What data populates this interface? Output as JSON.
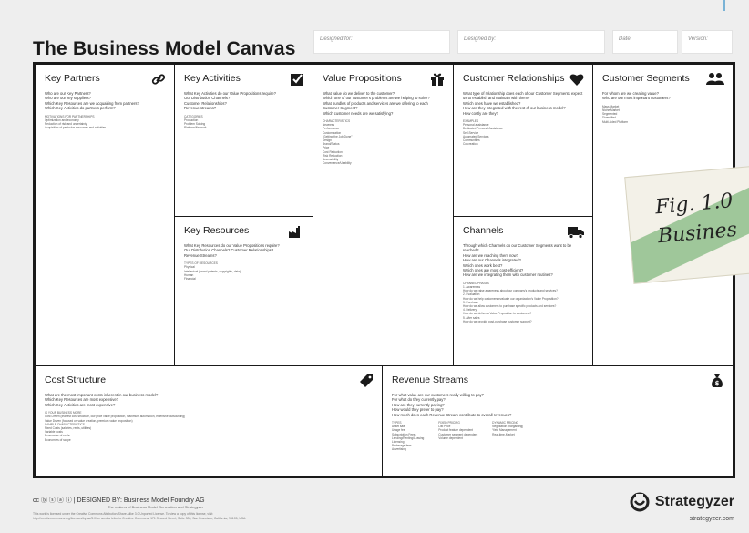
{
  "title": "The Business Model Canvas",
  "fields": {
    "designed_for": "Designed for:",
    "designed_by": "Designed by:",
    "date": "Date:",
    "version": "Version:"
  },
  "blocks": {
    "key_partners": {
      "title": "Key Partners",
      "questions": "Who are our Key Partners?\nWho are our key suppliers?\nWhich Key Resources are we acquairing from partners?\nWhich Key Activities do partners perform?",
      "sub": "MOTIVATIONS FOR PARTNERSHIPS\nOptimization and economy\nReduction of risk and uncertainty\nAcquisition of particular resources and activities"
    },
    "key_activities": {
      "title": "Key Activities",
      "questions": "What Key Activities do our Value Propositions require?\nOur Distribution Channels?\nCustomer Relationships?\nRevenue streams?",
      "sub": "CATEGORIES\nProduction\nProblem Solving\nPlatform/Network"
    },
    "key_resources": {
      "title": "Key Resources",
      "questions": "What Key Resources do our Value Propositions require?\nOur Distribution Channels? Customer Relationships?\nRevenue Streams?",
      "sub": "TYPES OF RESOURCES\nPhysical\nIntellectual (brand patents, copyrights, data)\nHuman\nFinancial"
    },
    "value_propositions": {
      "title": "Value Propositions",
      "questions": "What value do we deliver to the customer?\nWhich one of our customer's problems are we helping to solve?\nWhat bundles of products and services are we offering to each Customer Segment?\nWhich customer needs are we satisfying?",
      "sub": "CHARACTERISTICS\nNewness\nPerformance\nCustomization\n\"Getting the Job Done\"\nDesign\nBrand/Status\nPrice\nCost Reduction\nRisk Reduction\nAccessibility\nConvenience/Usability"
    },
    "customer_relationships": {
      "title": "Customer Relationships",
      "questions": "What type of relationship does each of our Customer Segments expect us to establish and maintain with them?\nWhich ones have we established?\nHow are they integrated with the rest of our business model?\nHow costly are they?",
      "sub": "EXAMPLES\nPersonal assistance\nDedicated Personal Assistance\nSelf-Service\nAutomated Services\nCommunities\nCo-creation"
    },
    "channels": {
      "title": "Channels",
      "questions": "Through which Channels do our Customer Segments want to be reached?\nHow are we reaching them now?\nHow are our Channels integrated?\nWhich ones work best?\nWhich ones are most cost-efficient?\nHow are we integrating them with customer routines?",
      "sub": "CHANNEL PHASES\n1. Awareness\nHow do we raise awareness about our company's products and services?\n2. Evaluation\nHow do we help customers evaluate our organization's Value Proposition?\n3. Purchase\nHow do we allow customers to purchase specific products and services?\n4. Delivery\nHow do we deliver a Value Proposition to customers?\n5. After sales\nHow do we provide post-purchase customer support?"
    },
    "customer_segments": {
      "title": "Customer Segments",
      "questions": "For whom are we creating value?\nWho are our most important customers?",
      "sub": "Mass Market\nNiche Market\nSegmented\nDiversified\nMulti-sided Platform"
    },
    "cost_structure": {
      "title": "Cost Structure",
      "questions": "What are the most important costs inherent in our business model?\nWhich Key Resources are most expensive?\nWhich Key Activities are most expensive?",
      "sub": "IS YOUR BUSINESS MORE\nCost Driven (leanest cost structure, low price value proposition, maximum automation, extensive outsourcing)\nValue Driven (focused on value creation, premium value proposition)\nSAMPLE CHARACTERISTICS\nFixed Costs (salaries, rents, utilities)\nVariable costs\nEconomies of scale\nEconomies of scope"
    },
    "revenue_streams": {
      "title": "Revenue Streams",
      "questions": "For what value are our customers really willing to pay?\nFor what do they currently pay?\nHow are they currently paying?\nHow would they prefer to pay?\nHow much does each Revenue Stream contribute to overall revenues?",
      "col1": "TYPES\nAsset sale\nUsage fee\nSubscription Fees\nLending/Renting/Leasing\nLicensing\nBrokerage fees\nAdvertising",
      "col2": "FIXED PRICING\nList Price\nProduct feature dependent\nCustomer segment dependent\nVolume dependent",
      "col3": "DYNAMIC PRICING\nNegotiation (bargaining)\nYield Management\nReal-time-Market"
    }
  },
  "footer": {
    "cc": "cc ⓑ ⓢ ⓐ ⓘ  |  DESIGNED BY: Business Model Foundry AG",
    "makers": "The makers of Business Model Generation and Strategyzer",
    "license": "This work is licensed under the Creative Commons Attribution-Share Alike 3.0 Unported License. To view a copy of this license, visit:\nhttp://creativecommons.org/licenses/by-sa/3.0/ or send a letter to Creative Commons, 171 Second Street, Suite 300, San Francisco, California, 94105, USA.",
    "brand": "Strategyzer",
    "url": "strategyzer.com"
  },
  "note": {
    "line1": "Fig. 1.0",
    "line2": "Busines"
  }
}
